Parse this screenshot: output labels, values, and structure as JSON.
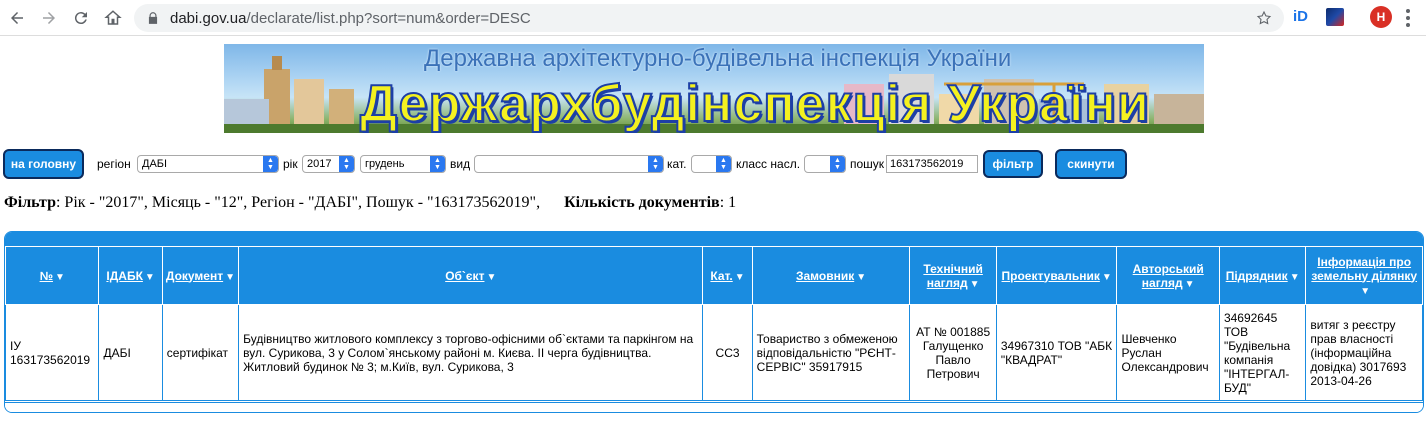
{
  "browser": {
    "url_host": "dabi.gov.ua",
    "url_path": "/declarate/list.php?sort=num&order=DESC",
    "ext_label": "iD",
    "profile_initial": "H"
  },
  "banner": {
    "top_title": "Державна архітектурно-будівельна інспекція України",
    "main_title": "Держархбудінспекція України"
  },
  "filters": {
    "home_button": "на головну",
    "region_label": "регіон",
    "region_value": "ДАБІ",
    "year_label": "рік",
    "year_value": "2017",
    "month_value": "грудень",
    "type_label": "вид",
    "type_value": "",
    "cat_label": "кат.",
    "cat_value": "",
    "class_label": "класс насл.",
    "class_value": "",
    "search_label": "пошук",
    "search_value": "163173562019",
    "filter_button": "фільтр",
    "reset_button": "скинути"
  },
  "summary": {
    "filter_label": "Фільтр",
    "filter_text": ": Рік - \"2017\", Місяць - \"12\", Регіон - \"ДАБІ\", Пошук - \"163173562019\",",
    "count_label": "Кількість документів",
    "count_text": ": 1"
  },
  "table": {
    "headers": {
      "num": "№",
      "idabk": "ІДАБК",
      "document": "Документ",
      "object": "Об`єкт",
      "cat": "Кат.",
      "customer": "Замовник",
      "tech_line1": "Технічний",
      "tech_line2": "нагляд",
      "designer": "Проектувальник",
      "author_line1": "Авторський",
      "author_line2": "нагляд",
      "contractor": "Підрядник",
      "land_line1": "Інформація про",
      "land_line2": "земельну ділянку"
    },
    "row": {
      "num": "ІУ 163173562019",
      "idabk": "ДАБІ",
      "document": "сертифікат",
      "object": "Будівництво житлового комплексу з торгово-офісними об`єктами та паркінгом на вул. Сурикова, 3 у Солом`янському районі м. Києва. ІІ черга будівництва. Житловий будинок № 3; м.Київ, вул. Сурикова, 3",
      "cat": "СС3",
      "customer": "Товариство з обмеженою відповідальністю \"РЄНТ-СЕРВІС\" 35917915",
      "tech": "АТ № 001885 Галущенко Павло Петрович",
      "designer": "34967310 ТОВ \"АБК \"КВАДРАТ\"",
      "author": "Шевченко Руслан Олександрович",
      "contractor": "34692645 ТОВ \"Будівельна компанія \"ІНТЕРГАЛ-БУД\"",
      "land": "витяг з реєстру прав власності (інформаційна довідка) 3017693 2013-04-26"
    },
    "sort_icon": "▼"
  }
}
